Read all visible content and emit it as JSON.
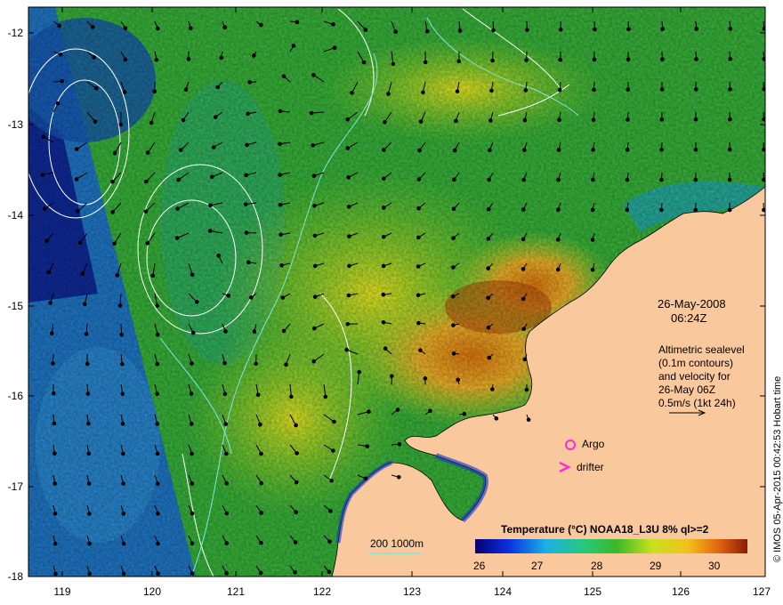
{
  "map": {
    "y_ticks": [
      "-12",
      "-13",
      "-14",
      "-15",
      "-16",
      "-17",
      "-18"
    ],
    "x_ticks": [
      "119",
      "120",
      "121",
      "122",
      "123",
      "124",
      "125",
      "126",
      "127"
    ],
    "date": "26-May-2008",
    "time": "06:24Z",
    "description": [
      "Altimetric sealevel",
      "(0.1m contours)",
      "and velocity for",
      "26-May 06Z",
      "0.5m/s (1kt 24h)"
    ],
    "legend_argo": "Argo",
    "legend_drifter": "drifter",
    "depth_label": "200  1000m",
    "colorbar_title": "Temperature (°C) NOAA18_L3U 8% ql>=2",
    "colorbar_ticks": [
      "26",
      "27",
      "28",
      "29",
      "30"
    ],
    "credit": "© IMOS 05-Apr-2015 00:42:53 Hobart time",
    "colors": {
      "land": "#f9c89d",
      "argo": "#ff2bd6",
      "drifter": "#ff2bd6",
      "depth_line": "#7fe5e5"
    }
  }
}
